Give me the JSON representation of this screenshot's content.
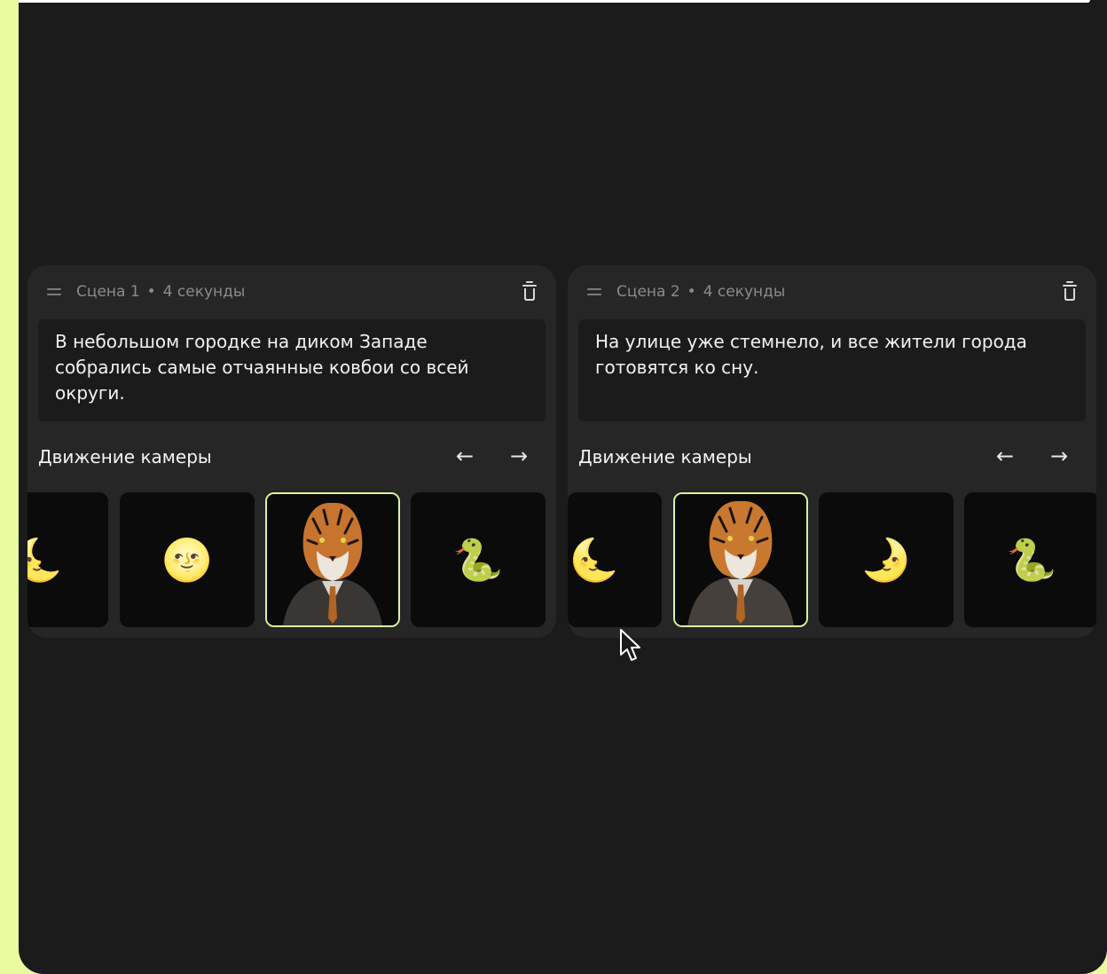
{
  "scenes": [
    {
      "name": "Сцена 1",
      "separator": "•",
      "duration": "4 секунды",
      "text": "В небольшом городке на диком Западе собрались самые отчаянные ковбои со всей округи.",
      "camera_label": "Движение камеры",
      "prev_arrow": "←",
      "next_arrow": "→",
      "thumbs": [
        {
          "icon": "crescent-moon-face-icon",
          "glyph": "🌜"
        },
        {
          "icon": "full-moon-face-icon",
          "glyph": "🌝"
        },
        {
          "icon": "tiger-in-suit-image",
          "glyph": ""
        },
        {
          "icon": "snake-icon",
          "glyph": "🐍"
        }
      ],
      "selected_index": 2
    },
    {
      "name": "Сцена 2",
      "separator": "•",
      "duration": "4 секунды",
      "text": "На улице уже стемнело, и все жители города готовятся ко сну.",
      "camera_label": "Движение камеры",
      "prev_arrow": "←",
      "next_arrow": "→",
      "thumbs": [
        {
          "icon": "crescent-moon-face-icon",
          "glyph": "🌜"
        },
        {
          "icon": "tiger-in-suit-image",
          "glyph": ""
        },
        {
          "icon": "first-quarter-moon-face-icon",
          "glyph": "🌛"
        },
        {
          "icon": "snake-icon",
          "glyph": "🐍"
        }
      ],
      "selected_index": 1
    }
  ],
  "colors": {
    "background": "#1b1b1c",
    "card": "#262627",
    "accent": "#d7f59b",
    "side_strip": "#e9fb9f"
  }
}
